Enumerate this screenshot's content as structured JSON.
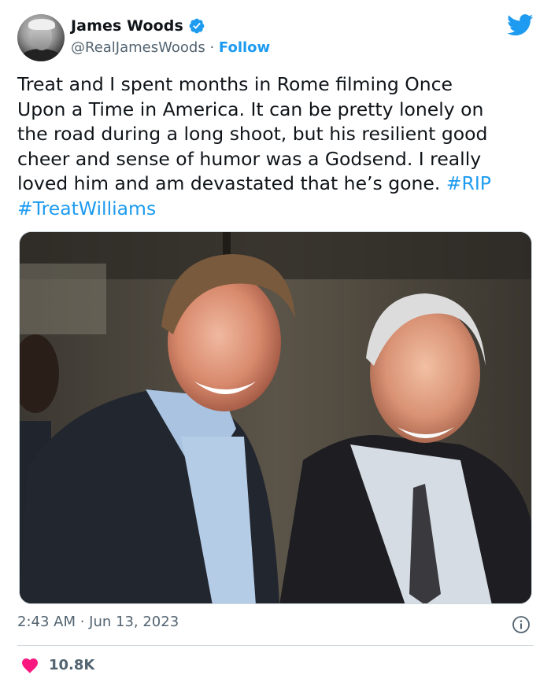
{
  "author": {
    "name": "James Woods",
    "handle": "@RealJamesWoods",
    "separator": "·",
    "follow_label": "Follow",
    "avatar_icon": "profile-photo",
    "verified_icon": "verified-badge-icon"
  },
  "platform_icon": "twitter-bird-icon",
  "tweet": {
    "lines": [
      "Treat and I spent months in Rome filming Once",
      "Upon a Time in America. It can be pretty lonely on",
      "the road during a long shoot, but his resilient good",
      "cheer and sense of humor was a Godsend. I really",
      "loved him and am devastated that he’s gone. "
    ],
    "hashtag_1": "#RIP",
    "hashtag_2": "#TreatWilliams"
  },
  "timestamp": "2:43 AM · Jun 13, 2023",
  "likes_count": "10.8K",
  "colors": {
    "accent": "#1d9bf0",
    "heart": "#f91880",
    "muted": "#536471",
    "text": "#0f1419"
  }
}
